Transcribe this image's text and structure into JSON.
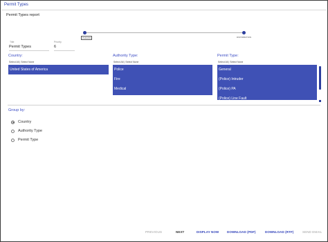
{
  "window_title": "Permit Types",
  "report_name": "Permit Types report",
  "stepper": {
    "steps": [
      "PARAMS",
      "DISTRIBUTION"
    ]
  },
  "fields": {
    "title_label": "Title",
    "title_value": "Permit Types",
    "priority_label": "Priority",
    "priority_value": "6"
  },
  "columns": {
    "country": {
      "title": "Country:",
      "select_all": "Select All",
      "separator": "|",
      "select_none": "Select None",
      "items": [
        "United States of America"
      ]
    },
    "authority": {
      "title": "Authority Type:",
      "select_all": "Select All",
      "separator": "|",
      "select_none": "Select None",
      "items": [
        "Police",
        "Fire",
        "Medical"
      ]
    },
    "permit": {
      "title": "Permit Type:",
      "select_all": "Select All",
      "separator": "|",
      "select_none": "Select None",
      "items": [
        "General",
        "(Police) Intruder",
        "(Police) PA",
        "(Police) Line Fault"
      ]
    }
  },
  "group_by": {
    "title": "Group by:",
    "options": [
      "Country",
      "Authority Type",
      "Permit Type"
    ],
    "selected": "Country"
  },
  "actions": {
    "previous": "PREVIOUS",
    "next": "NEXT",
    "display_now": "DISPLAY NOW",
    "download_pdf": "DOWNLOAD (PDF)",
    "download_rtf": "DOWNLOAD (RTF)",
    "send_email": "SEND EMAIL"
  },
  "colors": {
    "accent": "#3f51b5",
    "link": "#2c3eb8",
    "disabled": "#9e9e9e"
  }
}
